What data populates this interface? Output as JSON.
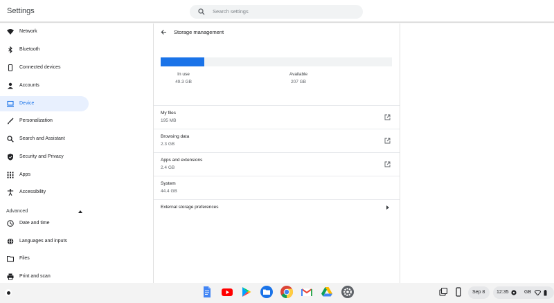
{
  "header": {
    "title": "Settings",
    "search_placeholder": "Search settings"
  },
  "sidebar": {
    "items": [
      {
        "label": "Network",
        "icon": "wifi-icon"
      },
      {
        "label": "Bluetooth",
        "icon": "bluetooth-icon"
      },
      {
        "label": "Connected devices",
        "icon": "phone-icon"
      },
      {
        "label": "Accounts",
        "icon": "person-icon"
      },
      {
        "label": "Device",
        "icon": "laptop-icon",
        "active": true
      },
      {
        "label": "Personalization",
        "icon": "brush-icon"
      },
      {
        "label": "Search and Assistant",
        "icon": "search-icon"
      },
      {
        "label": "Security and Privacy",
        "icon": "shield-icon"
      },
      {
        "label": "Apps",
        "icon": "grid-icon"
      },
      {
        "label": "Accessibility",
        "icon": "accessibility-icon"
      }
    ],
    "advanced_label": "Advanced",
    "advanced_items": [
      {
        "label": "Date and time",
        "icon": "clock-icon"
      },
      {
        "label": "Languages and inputs",
        "icon": "globe-icon"
      },
      {
        "label": "Files",
        "icon": "folder-icon"
      },
      {
        "label": "Print and scan",
        "icon": "printer-icon"
      }
    ]
  },
  "main": {
    "title": "Storage management",
    "usage_fraction": 0.19,
    "in_use_label": "In use",
    "in_use_value": "49.3 GB",
    "available_label": "Available",
    "available_value": "207 GB",
    "rows": [
      {
        "title": "My files",
        "value": "195 MB",
        "external": true
      },
      {
        "title": "Browsing data",
        "value": "2.3 GB",
        "external": true
      },
      {
        "title": "Apps and extensions",
        "value": "2.4 GB",
        "external": true
      },
      {
        "title": "System",
        "value": "44.4 GB",
        "external": false
      }
    ],
    "external_prefs_label": "External storage preferences"
  },
  "shelf": {
    "apps": [
      "docs-icon",
      "youtube-icon",
      "play-store-icon",
      "files-icon",
      "chrome-icon",
      "gmail-icon",
      "drive-icon",
      "settings-icon"
    ],
    "date": "Sep 8",
    "time": "12:35",
    "locale": "GB"
  },
  "colors": {
    "accent": "#1a73e8",
    "active_nav_bg": "#e8f0fe"
  }
}
